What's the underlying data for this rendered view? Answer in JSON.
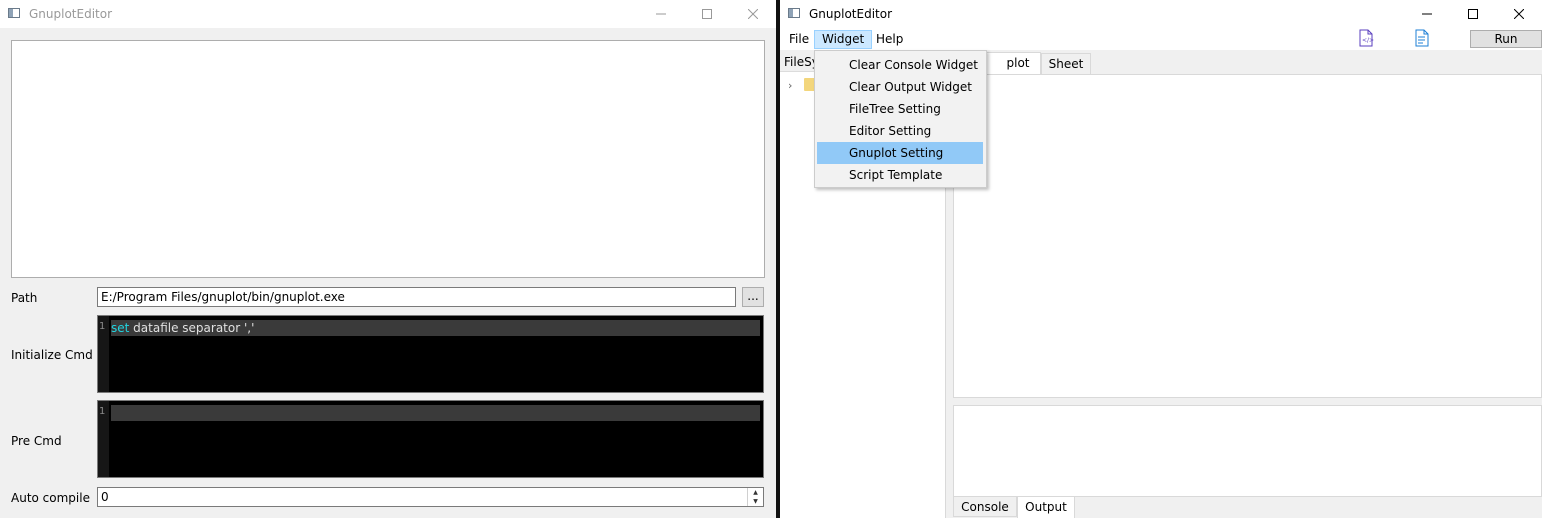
{
  "left_window": {
    "title": "GnuplotEditor",
    "path_label": "Path",
    "path_value": "E:/Program Files/gnuplot/bin/gnuplot.exe",
    "browse_label": "...",
    "init_label": "Initialize Cmd",
    "init_line_no": "1",
    "init_keyword": "set",
    "init_rest": " datafile separator ','",
    "pre_label": "Pre Cmd",
    "pre_line_no": "1",
    "auto_label": "Auto compile",
    "auto_value": "0"
  },
  "right_window": {
    "title": "GnuplotEditor",
    "menus": [
      "File",
      "Widget",
      "Help"
    ],
    "run_label": "Run",
    "filesystem_header": "FileSy",
    "top_tabs": [
      "plot",
      "Sheet"
    ],
    "bottom_tabs": [
      "Console",
      "Output"
    ],
    "widget_menu": [
      "Clear Console Widget",
      "Clear Output Widget",
      "FileTree Setting",
      "Editor Setting",
      "Gnuplot Setting",
      "Script Template"
    ],
    "highlighted_item": "Gnuplot Setting"
  },
  "colors": {
    "keyword": "#22d4e0",
    "menu_highlight": "#91c9f7",
    "menu_active": "#cce8ff"
  }
}
